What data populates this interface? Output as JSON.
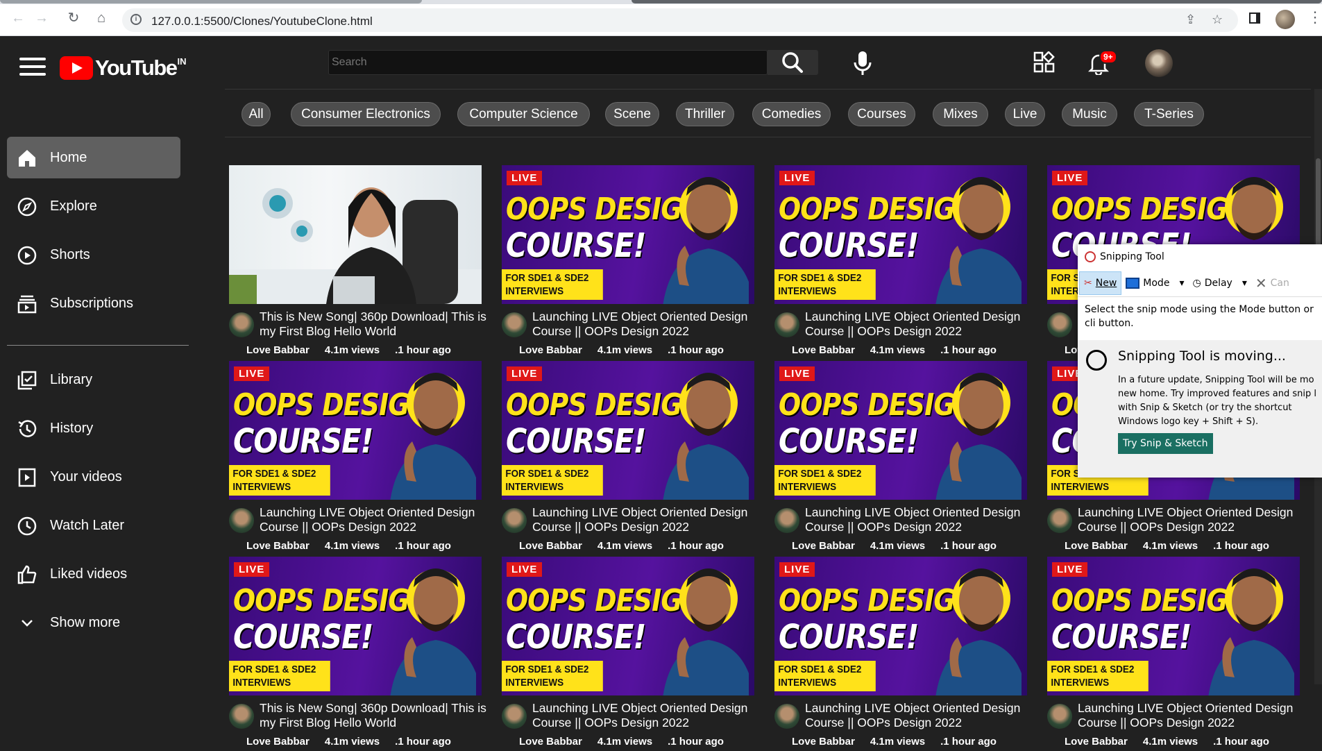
{
  "browser": {
    "url": "127.0.0.1:5500/Clones/YoutubeClone.html"
  },
  "header": {
    "logo_text": "YouTube",
    "region": "IN",
    "search_placeholder": "Search",
    "notification_count": "9+"
  },
  "sidebar": {
    "items": [
      {
        "label": "Home",
        "icon": "home-icon",
        "active": true
      },
      {
        "label": "Explore",
        "icon": "compass-icon"
      },
      {
        "label": "Shorts",
        "icon": "shorts-icon"
      },
      {
        "label": "Subscriptions",
        "icon": "subscriptions-icon"
      },
      {
        "label": "Library",
        "icon": "library-icon"
      },
      {
        "label": "History",
        "icon": "history-icon"
      },
      {
        "label": "Your videos",
        "icon": "your-videos-icon"
      },
      {
        "label": "Watch Later",
        "icon": "clock-icon"
      },
      {
        "label": "Liked videos",
        "icon": "thumbs-up-icon"
      },
      {
        "label": "Show more",
        "icon": "chevron-down-icon"
      }
    ]
  },
  "chips": [
    "All",
    "Consumer Electronics",
    "Computer Science",
    "Scene",
    "Thriller",
    "Comedies",
    "Courses",
    "Mixes",
    "Live",
    "Music",
    "T-Series"
  ],
  "course_thumb": {
    "live": "LIVE",
    "line1": "OOPS DESIGN",
    "line2": "COURSE!",
    "tag": "FOR SDE1 & SDE2 INTERVIEWS"
  },
  "videos": [
    {
      "title": "This is New Song| 360p Download| This is my First Blog Hello World",
      "channel": "Love Babbar",
      "views": "4.1m views",
      "time": ".1 hour ago"
    },
    {
      "title": "Launching LIVE Object Oriented Design Course || OOPs Design 2022",
      "channel": "Love Babbar",
      "views": "4.1m views",
      "time": ".1 hour ago"
    },
    {
      "title": "Launching LIVE Object Oriented Design Course || OOPs Design 2022",
      "channel": "Love Babbar",
      "views": "4.1m views",
      "time": ".1 hour ago"
    },
    {
      "title": "Launching LIVE Object Oriented Design Course || OOPs Design 2022",
      "channel": "Love Babbar",
      "views": "4.1m views",
      "time": ".1 hour ago"
    },
    {
      "title": "Launching LIVE Object Oriented Design Course || OOPs Design 2022",
      "channel": "Love Babbar",
      "views": "4.1m views",
      "time": ".1 hour ago"
    },
    {
      "title": "Launching LIVE Object Oriented Design Course || OOPs Design 2022",
      "channel": "Love Babbar",
      "views": "4.1m views",
      "time": ".1 hour ago"
    },
    {
      "title": "Launching LIVE Object Oriented Design Course || OOPs Design 2022",
      "channel": "Love Babbar",
      "views": "4.1m views",
      "time": ".1 hour ago"
    },
    {
      "title": "Launching LIVE Object Oriented Design Course || OOPs Design 2022",
      "channel": "Love Babbar",
      "views": "4.1m views",
      "time": ".1 hour ago"
    }
  ],
  "snipping_tool": {
    "title": "Snipping Tool",
    "new_label": "New",
    "mode_label": "Mode",
    "delay_label": "Delay",
    "cancel_label": "Can",
    "instruction": "Select the snip mode using the Mode button or cli button.",
    "notice_title": "Snipping Tool is moving...",
    "notice_body": "In a future update, Snipping Tool will be mo new home. Try improved features and snip l with Snip & Sketch (or try the shortcut Windows logo key + Shift + S).",
    "try_button": "Try Snip & Sketch"
  }
}
